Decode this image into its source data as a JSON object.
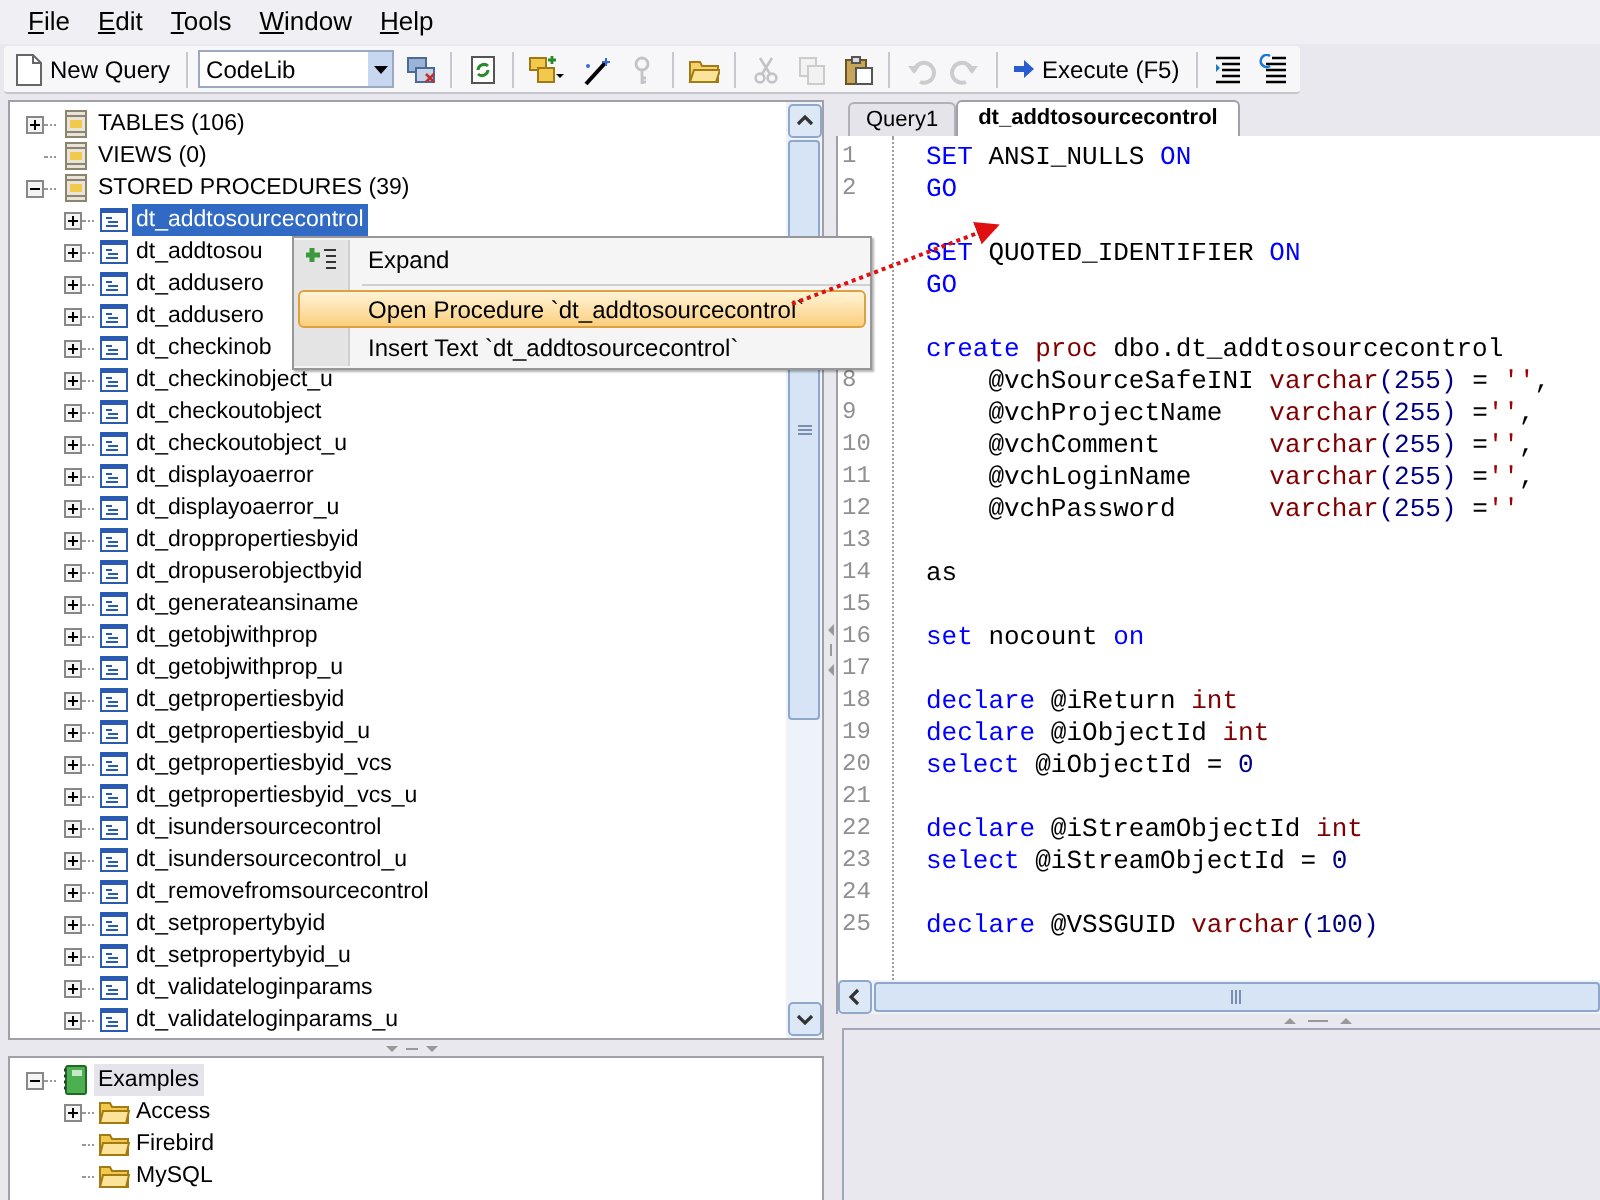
{
  "menu": [
    {
      "label": "File"
    },
    {
      "label": "Edit"
    },
    {
      "label": "Tools"
    },
    {
      "label": "Window"
    },
    {
      "label": "Help"
    }
  ],
  "toolbar": [
    {
      "kind": "button",
      "label": "New Query"
    },
    {
      "kind": "separator"
    },
    {
      "kind": "combo",
      "value": "CodeLib"
    },
    {
      "kind": "icon",
      "disabled": false
    },
    {
      "kind": "separator"
    },
    {
      "kind": "icon",
      "disabled": false
    },
    {
      "kind": "separator"
    },
    {
      "kind": "icon",
      "disabled": false
    },
    {
      "kind": "icon",
      "disabled": false
    },
    {
      "kind": "icon",
      "disabled": true
    },
    {
      "kind": "separator"
    },
    {
      "kind": "icon",
      "disabled": false
    },
    {
      "kind": "separator"
    },
    {
      "kind": "icon",
      "disabled": true
    },
    {
      "kind": "icon",
      "disabled": true
    },
    {
      "kind": "icon",
      "disabled": false
    },
    {
      "kind": "separator"
    },
    {
      "kind": "icon",
      "disabled": true
    },
    {
      "kind": "icon",
      "disabled": true
    },
    {
      "kind": "separator"
    },
    {
      "kind": "button",
      "label": "Execute (F5)"
    },
    {
      "kind": "separator"
    },
    {
      "kind": "icon",
      "disabled": false
    },
    {
      "kind": "icon",
      "disabled": false
    }
  ],
  "object_tree": [
    {
      "label": "TABLES (106)",
      "expanded": false,
      "selected": false
    },
    {
      "label": "VIEWS (0)",
      "selected": false
    },
    {
      "label": "STORED PROCEDURES (39)",
      "expanded": true,
      "selected": false,
      "children": [
        {
          "label": "dt_addtosourcecontrol",
          "expanded": false,
          "selected": true
        },
        {
          "label": "dt_addtosou",
          "expanded": false,
          "selected": false
        },
        {
          "label": "dt_addusero",
          "expanded": false,
          "selected": false
        },
        {
          "label": "dt_addusero",
          "expanded": false,
          "selected": false
        },
        {
          "label": "dt_checkinob",
          "expanded": false,
          "selected": false
        },
        {
          "label": "dt_checkinobject_u",
          "expanded": false,
          "selected": false
        },
        {
          "label": "dt_checkoutobject",
          "expanded": false,
          "selected": false
        },
        {
          "label": "dt_checkoutobject_u",
          "expanded": false,
          "selected": false
        },
        {
          "label": "dt_displayoaerror",
          "expanded": false,
          "selected": false
        },
        {
          "label": "dt_displayoaerror_u",
          "expanded": false,
          "selected": false
        },
        {
          "label": "dt_droppropertiesbyid",
          "expanded": false,
          "selected": false
        },
        {
          "label": "dt_dropuserobjectbyid",
          "expanded": false,
          "selected": false
        },
        {
          "label": "dt_generateansiname",
          "expanded": false,
          "selected": false
        },
        {
          "label": "dt_getobjwithprop",
          "expanded": false,
          "selected": false
        },
        {
          "label": "dt_getobjwithprop_u",
          "expanded": false,
          "selected": false
        },
        {
          "label": "dt_getpropertiesbyid",
          "expanded": false,
          "selected": false
        },
        {
          "label": "dt_getpropertiesbyid_u",
          "expanded": false,
          "selected": false
        },
        {
          "label": "dt_getpropertiesbyid_vcs",
          "expanded": false,
          "selected": false
        },
        {
          "label": "dt_getpropertiesbyid_vcs_u",
          "expanded": false,
          "selected": false
        },
        {
          "label": "dt_isundersourcecontrol",
          "expanded": false,
          "selected": false
        },
        {
          "label": "dt_isundersourcecontrol_u",
          "expanded": false,
          "selected": false
        },
        {
          "label": "dt_removefromsourcecontrol",
          "expanded": false,
          "selected": false
        },
        {
          "label": "dt_setpropertybyid",
          "expanded": false,
          "selected": false
        },
        {
          "label": "dt_setpropertybyid_u",
          "expanded": false,
          "selected": false
        },
        {
          "label": "dt_validateloginparams",
          "expanded": false,
          "selected": false
        },
        {
          "label": "dt_validateloginparams_u",
          "expanded": false,
          "selected": false
        }
      ]
    }
  ],
  "library_tree": [
    {
      "label": "Examples",
      "expanded": true,
      "selected": true,
      "children": [
        {
          "label": "Access",
          "expanded": false,
          "selected": false
        },
        {
          "label": "Firebird",
          "selected": false
        },
        {
          "label": "MySQL",
          "selected": false
        }
      ]
    }
  ],
  "context_menu": [
    {
      "kind": "item",
      "label": "Expand",
      "selected": false
    },
    {
      "kind": "separator"
    },
    {
      "kind": "item",
      "label": "Open Procedure `dt_addtosourcecontrol`",
      "selected": true
    },
    {
      "kind": "item",
      "label": "Insert Text `dt_addtosourcecontrol`",
      "selected": false
    }
  ],
  "tabs": [
    {
      "label": "Query1",
      "selected": false
    },
    {
      "label": "dt_addtosourcecontrol",
      "selected": true
    }
  ],
  "code": [
    {
      "kind": "code",
      "number": "1",
      "tokens": [
        {
          "kind": "keyword",
          "text": "SET"
        },
        {
          "kind": "plain",
          "text": " ANSI_NULLS "
        },
        {
          "kind": "keyword",
          "text": "ON"
        }
      ]
    },
    {
      "kind": "code",
      "number": "2",
      "tokens": [
        {
          "kind": "keyword",
          "text": "GO"
        }
      ]
    },
    {
      "kind": "blank"
    },
    {
      "kind": "code",
      "tokens": [
        {
          "kind": "keyword",
          "text": "SET"
        },
        {
          "kind": "plain",
          "text": " QUOTED_IDENTIFIER "
        },
        {
          "kind": "keyword",
          "text": "ON"
        }
      ]
    },
    {
      "kind": "code",
      "tokens": [
        {
          "kind": "keyword",
          "text": "GO"
        }
      ]
    },
    {
      "kind": "blank"
    },
    {
      "kind": "code",
      "tokens": [
        {
          "kind": "keyword",
          "text": "create"
        },
        {
          "kind": "type",
          "text": " proc"
        },
        {
          "kind": "plain",
          "text": " dbo.dt_addtosourcecontrol"
        }
      ]
    },
    {
      "kind": "code",
      "number": "8",
      "tokens": [
        {
          "kind": "plain",
          "text": "    @vchSourceSafeINI "
        },
        {
          "kind": "type",
          "text": "varchar"
        },
        {
          "kind": "number",
          "text": "(255)"
        },
        {
          "kind": "plain",
          "text": " = "
        },
        {
          "kind": "string",
          "text": "''"
        },
        {
          "kind": "plain",
          "text": ","
        }
      ]
    },
    {
      "kind": "code",
      "number": "9",
      "tokens": [
        {
          "kind": "plain",
          "text": "    @vchProjectName   "
        },
        {
          "kind": "type",
          "text": "varchar"
        },
        {
          "kind": "number",
          "text": "(255)"
        },
        {
          "kind": "plain",
          "text": " ="
        },
        {
          "kind": "string",
          "text": "''"
        },
        {
          "kind": "plain",
          "text": ","
        }
      ]
    },
    {
      "kind": "code",
      "number": "10",
      "tokens": [
        {
          "kind": "plain",
          "text": "    @vchComment       "
        },
        {
          "kind": "type",
          "text": "varchar"
        },
        {
          "kind": "number",
          "text": "(255)"
        },
        {
          "kind": "plain",
          "text": " ="
        },
        {
          "kind": "string",
          "text": "''"
        },
        {
          "kind": "plain",
          "text": ","
        }
      ]
    },
    {
      "kind": "code",
      "number": "11",
      "tokens": [
        {
          "kind": "plain",
          "text": "    @vchLoginName     "
        },
        {
          "kind": "type",
          "text": "varchar"
        },
        {
          "kind": "number",
          "text": "(255)"
        },
        {
          "kind": "plain",
          "text": " ="
        },
        {
          "kind": "string",
          "text": "''"
        },
        {
          "kind": "plain",
          "text": ","
        }
      ]
    },
    {
      "kind": "code",
      "number": "12",
      "tokens": [
        {
          "kind": "plain",
          "text": "    @vchPassword      "
        },
        {
          "kind": "type",
          "text": "varchar"
        },
        {
          "kind": "number",
          "text": "(255)"
        },
        {
          "kind": "plain",
          "text": " ="
        },
        {
          "kind": "string",
          "text": "''"
        }
      ]
    },
    {
      "kind": "blank",
      "number": "13"
    },
    {
      "kind": "code",
      "number": "14",
      "tokens": [
        {
          "kind": "plain",
          "text": "as"
        }
      ]
    },
    {
      "kind": "blank",
      "number": "15"
    },
    {
      "kind": "code",
      "number": "16",
      "tokens": [
        {
          "kind": "keyword",
          "text": "set"
        },
        {
          "kind": "plain",
          "text": " nocount "
        },
        {
          "kind": "keyword",
          "text": "on"
        }
      ]
    },
    {
      "kind": "blank",
      "number": "17"
    },
    {
      "kind": "code",
      "number": "18",
      "tokens": [
        {
          "kind": "keyword",
          "text": "declare"
        },
        {
          "kind": "plain",
          "text": " @iReturn "
        },
        {
          "kind": "type",
          "text": "int"
        }
      ]
    },
    {
      "kind": "code",
      "number": "19",
      "tokens": [
        {
          "kind": "keyword",
          "text": "declare"
        },
        {
          "kind": "plain",
          "text": " @iObjectId "
        },
        {
          "kind": "type",
          "text": "int"
        }
      ]
    },
    {
      "kind": "code",
      "number": "20",
      "tokens": [
        {
          "kind": "keyword",
          "text": "select"
        },
        {
          "kind": "plain",
          "text": " @iObjectId = "
        },
        {
          "kind": "number",
          "text": "0"
        }
      ]
    },
    {
      "kind": "blank",
      "number": "21"
    },
    {
      "kind": "code",
      "number": "22",
      "tokens": [
        {
          "kind": "keyword",
          "text": "declare"
        },
        {
          "kind": "plain",
          "text": " @iStreamObjectId "
        },
        {
          "kind": "type",
          "text": "int"
        }
      ]
    },
    {
      "kind": "code",
      "number": "23",
      "tokens": [
        {
          "kind": "keyword",
          "text": "select"
        },
        {
          "kind": "plain",
          "text": " @iStreamObjectId = "
        },
        {
          "kind": "number",
          "text": "0"
        }
      ]
    },
    {
      "kind": "blank",
      "number": "24"
    },
    {
      "kind": "code",
      "number": "25",
      "tokens": [
        {
          "kind": "keyword",
          "text": "declare"
        },
        {
          "kind": "plain",
          "text": " @VSSGUID "
        },
        {
          "kind": "type",
          "text": "varchar"
        },
        {
          "kind": "number",
          "text": "(100)"
        }
      ]
    }
  ]
}
